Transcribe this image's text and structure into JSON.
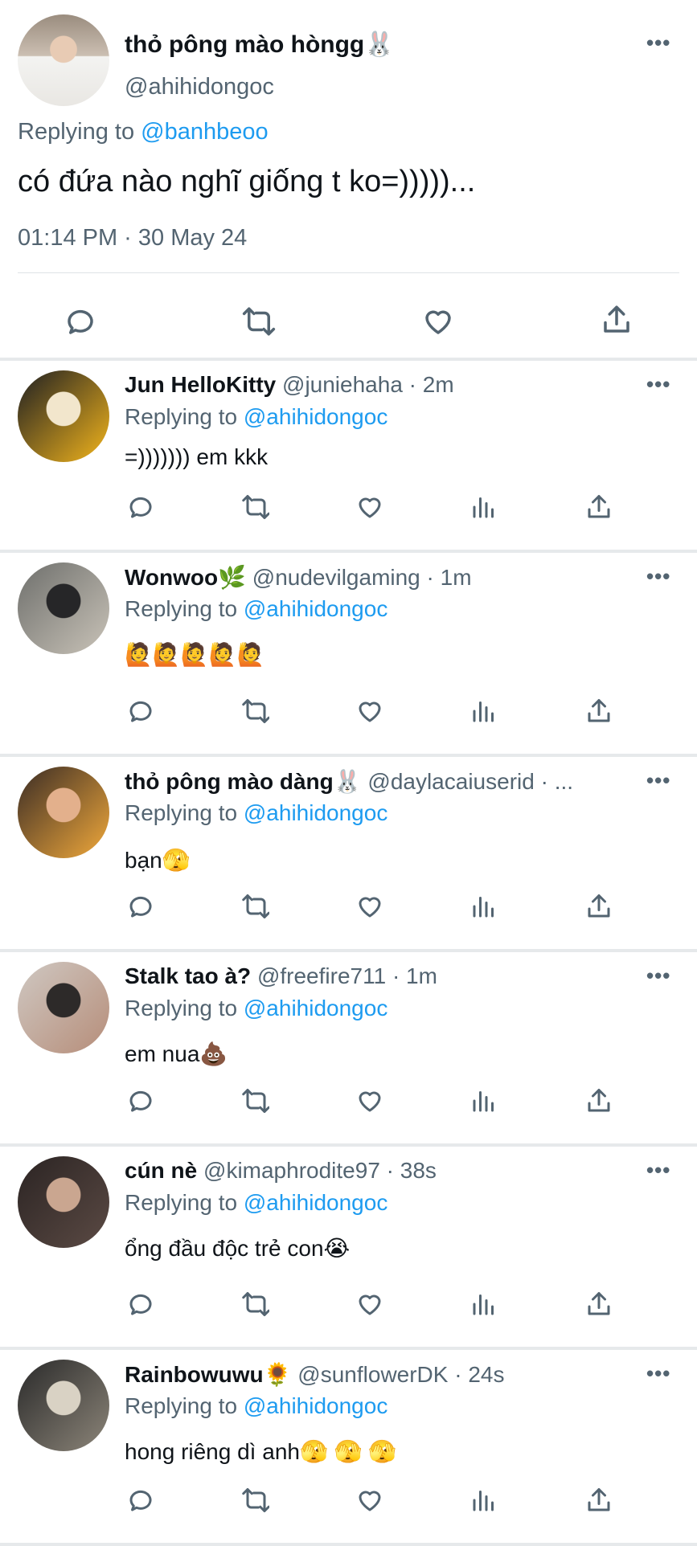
{
  "main_tweet": {
    "name": "thỏ pông mào hòngg🐰",
    "handle": "@ahihidongoc",
    "replying_prefix": "Replying to",
    "replying_to": "@banhbeoo",
    "text": "có đứa nào nghĩ giống t ko=)))))...",
    "timestamp": "01:14 PM · 30 May 24",
    "actions": [
      "reply-icon",
      "retweet-icon",
      "like-icon",
      "share-icon"
    ]
  },
  "more_label": "•••",
  "replies": [
    {
      "name": "Jun HelloKitty",
      "meta": "@juniehaha · 2m",
      "replying_prefix": "Replying to",
      "replying_to": "@ahihidongoc",
      "text": "=))))))) em kkk",
      "avatar_colors": [
        "#1e1f22",
        "#f2e6cc",
        "#f3b51c"
      ]
    },
    {
      "name": "Wonwoo🌿",
      "meta": "@nudevilgaming · 1m",
      "replying_prefix": "Replying to",
      "replying_to": "@ahihidongoc",
      "text": "🙋🙋🙋🙋🙋",
      "avatar_colors": [
        "#6e6f6c",
        "#262628",
        "#c9c3b8"
      ]
    },
    {
      "name": "thỏ pông mào dàng🐰",
      "meta": "@daylacaiuserid · ...",
      "replying_prefix": "Replying to",
      "replying_to": "@ahihidongoc",
      "text": "bạn🫣",
      "avatar_colors": [
        "#3a2c25",
        "#e3b08c",
        "#f1a93b"
      ]
    },
    {
      "name": "Stalk tao à?",
      "meta": "@freefire711 · 1m",
      "replying_prefix": "Replying to",
      "replying_to": "@ahihidongoc",
      "text": "em nua💩",
      "avatar_colors": [
        "#cfc8c2",
        "#2d2a29",
        "#b68d79"
      ]
    },
    {
      "name": "cún nè",
      "meta": "@kimaphrodite97 · 38s",
      "replying_prefix": "Replying to",
      "replying_to": "@ahihidongoc",
      "text": "ổng đầu độc trẻ con😭",
      "avatar_colors": [
        "#2b2423",
        "#caa690",
        "#5b4a44"
      ]
    },
    {
      "name": "Rainbowuwu🌻",
      "meta": "@sunflowerDK · 24s",
      "replying_prefix": "Replying to",
      "replying_to": "@ahihidongoc",
      "text": "hong riêng dì anh🫣 🫣 🫣",
      "avatar_colors": [
        "#2a2a2a",
        "#d9d2c4",
        "#8c8579"
      ]
    }
  ],
  "reply_actions": [
    "reply-icon",
    "retweet-icon",
    "like-icon",
    "views-icon",
    "share-icon"
  ],
  "colors": {
    "accent": "#1d9bf0",
    "muted": "#536471",
    "text": "#0f1419"
  }
}
